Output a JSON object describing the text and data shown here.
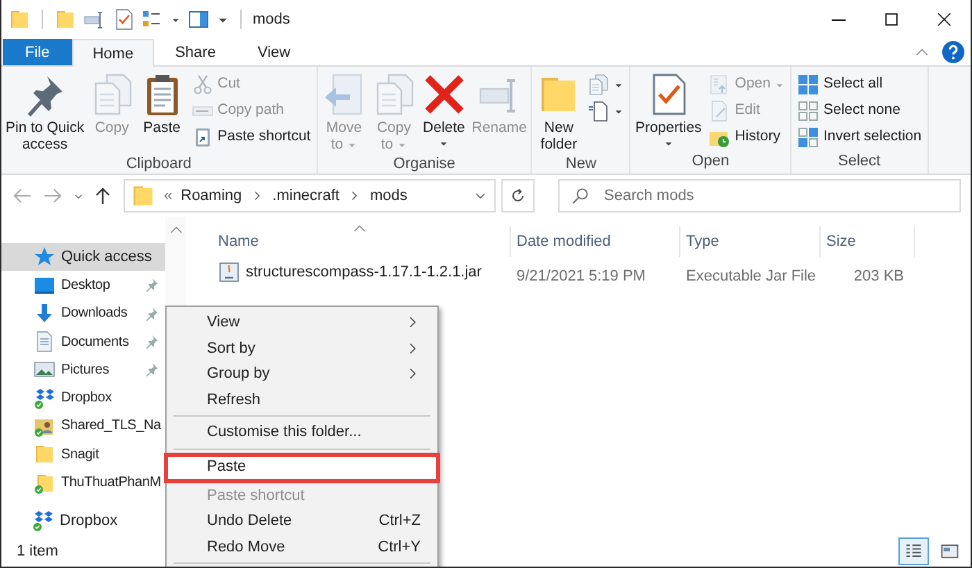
{
  "window": {
    "title": "mods"
  },
  "ribbon_tabs": [
    {
      "label": "File",
      "kind": "file",
      "selected": false
    },
    {
      "label": "Home",
      "kind": "tab",
      "selected": true
    },
    {
      "label": "Share",
      "kind": "tab",
      "selected": false
    },
    {
      "label": "View",
      "kind": "tab",
      "selected": false
    }
  ],
  "ribbon_groups": [
    {
      "label": "Clipboard",
      "commands": [
        {
          "kind": "large",
          "label": "Pin to Quick\naccess",
          "disabled": false
        },
        {
          "kind": "large",
          "label": "Copy",
          "disabled": true
        },
        {
          "kind": "large",
          "label": "Paste",
          "disabled": false
        },
        {
          "kind": "small",
          "label": "Cut",
          "disabled": true
        },
        {
          "kind": "small",
          "label": "Copy path",
          "disabled": true
        },
        {
          "kind": "small",
          "label": "Paste shortcut",
          "disabled": false
        }
      ]
    },
    {
      "label": "Organise",
      "commands": [
        {
          "kind": "large",
          "label": "Move\nto",
          "disabled": true,
          "has_menu": true
        },
        {
          "kind": "large",
          "label": "Copy\nto",
          "disabled": true,
          "has_menu": true
        },
        {
          "kind": "large",
          "label": "Delete",
          "disabled": false,
          "has_menu": true
        },
        {
          "kind": "large",
          "label": "Rename",
          "disabled": true
        }
      ]
    },
    {
      "label": "New",
      "commands": [
        {
          "kind": "large",
          "label": "New\nfolder",
          "disabled": false
        },
        {
          "kind": "small",
          "disabled": false,
          "has_menu": true
        },
        {
          "kind": "small",
          "disabled": false,
          "has_menu": true
        }
      ]
    },
    {
      "label": "Open",
      "commands": [
        {
          "kind": "large",
          "label": "Properties",
          "disabled": false,
          "has_menu": true
        },
        {
          "kind": "small",
          "label": "Open",
          "disabled": true,
          "has_menu": true
        },
        {
          "kind": "small",
          "label": "Edit",
          "disabled": true
        },
        {
          "kind": "small",
          "label": "History",
          "disabled": false
        }
      ]
    },
    {
      "label": "Select",
      "commands": [
        {
          "kind": "small",
          "label": "Select all",
          "disabled": false
        },
        {
          "kind": "small",
          "label": "Select none",
          "disabled": false
        },
        {
          "kind": "small",
          "label": "Invert selection",
          "disabled": false
        }
      ]
    }
  ],
  "address": {
    "overflow": "«",
    "crumbs": [
      "Roaming",
      ".minecraft",
      "mods"
    ]
  },
  "search": {
    "placeholder": "Search mods"
  },
  "sidebar": {
    "items": [
      {
        "label": "Quick access",
        "selected": true,
        "children": [
          {
            "label": "Desktop",
            "selected": false,
            "pinned": true
          },
          {
            "label": "Downloads",
            "selected": false,
            "pinned": true
          },
          {
            "label": "Documents",
            "selected": false,
            "pinned": true
          },
          {
            "label": "Pictures",
            "selected": false,
            "pinned": true
          },
          {
            "label": "Dropbox",
            "selected": false,
            "pinned": false
          },
          {
            "label": "Shared_TLS_Na",
            "selected": false,
            "pinned": false
          },
          {
            "label": "Snagit",
            "selected": false,
            "pinned": false
          },
          {
            "label": "ThuThuatPhanM",
            "selected": false,
            "pinned": false
          }
        ]
      },
      {
        "label": "Dropbox",
        "selected": false
      }
    ]
  },
  "file_list": {
    "columns": [
      {
        "label": "Name",
        "sorted": true
      },
      {
        "label": "Date modified",
        "sorted": false
      },
      {
        "label": "Type",
        "sorted": false
      },
      {
        "label": "Size",
        "sorted": false
      }
    ],
    "rows": [
      {
        "cells": [
          "structurescompass-1.17.1-1.2.1.jar",
          "9/21/2021 5:19 PM",
          "Executable Jar File",
          "203 KB"
        ]
      }
    ]
  },
  "context_menu": {
    "items": [
      {
        "kind": "item",
        "label": "View",
        "submenu": true,
        "disabled": false,
        "highlighted": false
      },
      {
        "kind": "item",
        "label": "Sort by",
        "submenu": true,
        "disabled": false,
        "highlighted": false
      },
      {
        "kind": "item",
        "label": "Group by",
        "submenu": true,
        "disabled": false,
        "highlighted": false
      },
      {
        "kind": "item",
        "label": "Refresh",
        "submenu": false,
        "disabled": false,
        "highlighted": false
      },
      {
        "kind": "separator"
      },
      {
        "kind": "item",
        "label": "Customise this folder...",
        "submenu": false,
        "disabled": false,
        "highlighted": false
      },
      {
        "kind": "separator"
      },
      {
        "kind": "item",
        "label": "Paste",
        "submenu": false,
        "disabled": false,
        "highlighted": true
      },
      {
        "kind": "item",
        "label": "Paste shortcut",
        "submenu": false,
        "disabled": true,
        "highlighted": false
      },
      {
        "kind": "item",
        "label": "Undo Delete",
        "shortcut": "Ctrl+Z",
        "submenu": false,
        "disabled": false,
        "highlighted": false
      },
      {
        "kind": "item",
        "label": "Redo Move",
        "shortcut": "Ctrl+Y",
        "submenu": false,
        "disabled": false,
        "highlighted": false
      },
      {
        "kind": "separator"
      }
    ]
  },
  "status_bar": {
    "item_count": "1 item",
    "view_buttons": [
      {
        "selected": true
      },
      {
        "selected": false
      }
    ]
  }
}
